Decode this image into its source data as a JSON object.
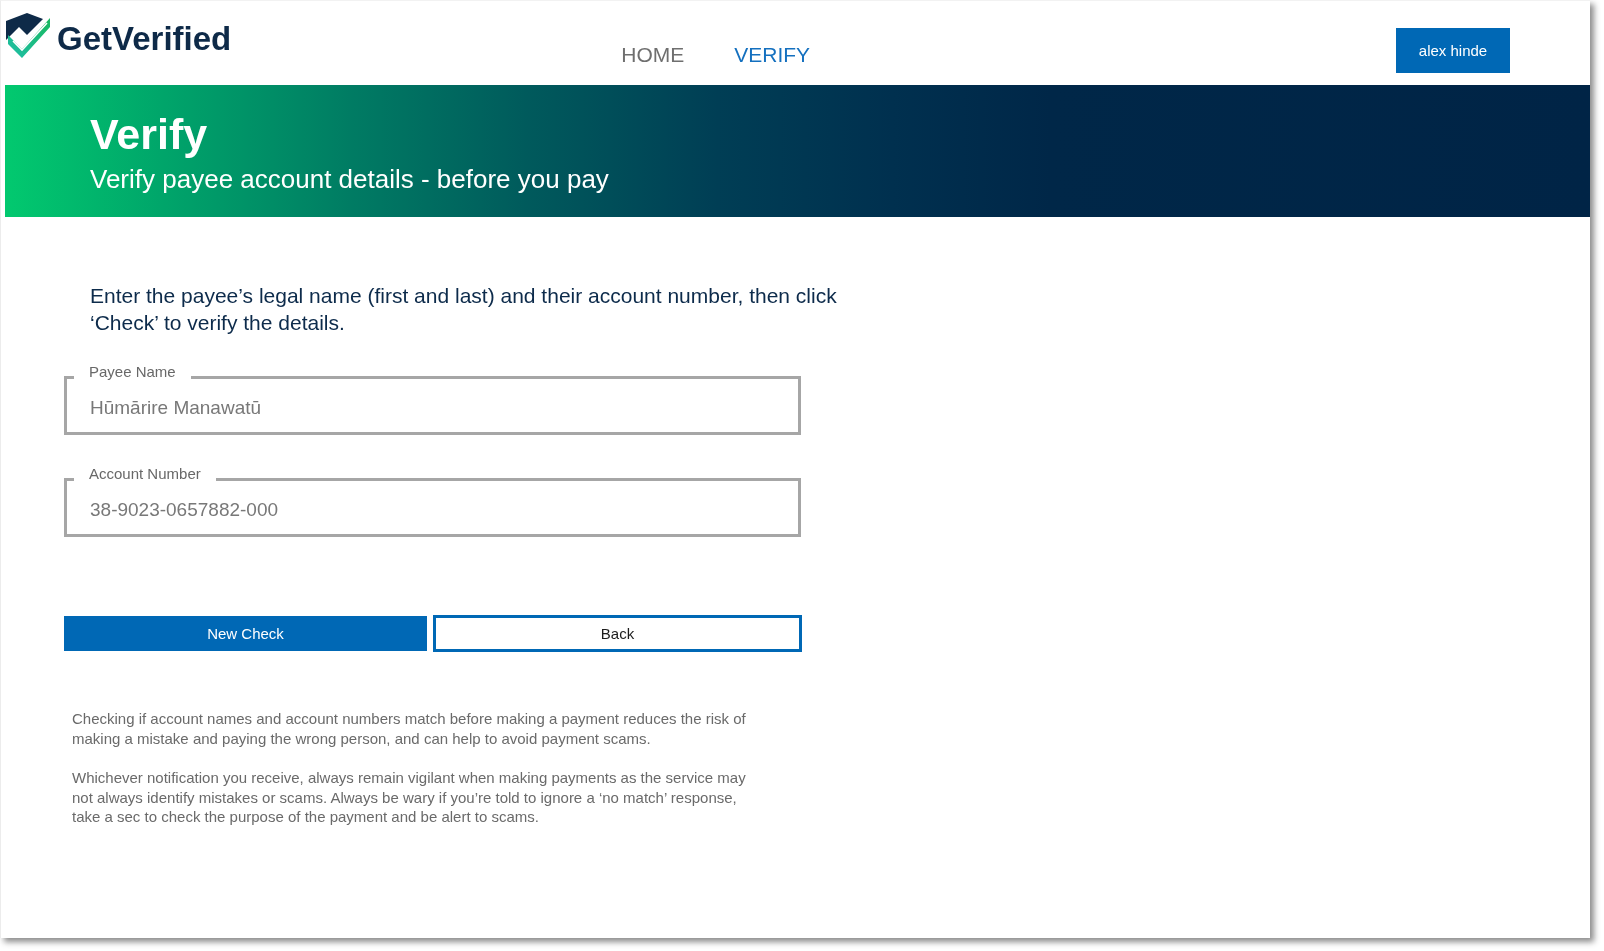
{
  "logo": {
    "text": "GetVerified"
  },
  "nav": {
    "items": [
      {
        "label": "HOME",
        "selected": false
      },
      {
        "label": "VERIFY",
        "selected": true
      }
    ]
  },
  "user_button": {
    "label": "alex hinde"
  },
  "banner": {
    "title": "Verify",
    "subtitle": "Verify payee account details - before you pay"
  },
  "instructions": "Enter the payee’s legal name (first and last) and their account number, then click ‘Check’ to verify the details.",
  "fields": [
    {
      "label": "Payee Name",
      "value": "Hūmārire Manawatū"
    },
    {
      "label": "Account Number",
      "value": "38-9023-0657882-000"
    }
  ],
  "buttons": [
    {
      "label": "New Check",
      "kind": "primary"
    },
    {
      "label": "Back",
      "kind": "secondary"
    }
  ],
  "notes": [
    "Checking if account names and account numbers match before making a payment  reduces the risk of making a mistake and paying the wrong person, and can help to avoid payment scams.",
    "Whichever notification you receive, always remain vigilant when making payments as the service may not always identify mistakes or scams. Always be wary if you’re told to ignore a ‘no match’ response, take a sec to check the purpose of the payment and be alert to scams."
  ]
}
